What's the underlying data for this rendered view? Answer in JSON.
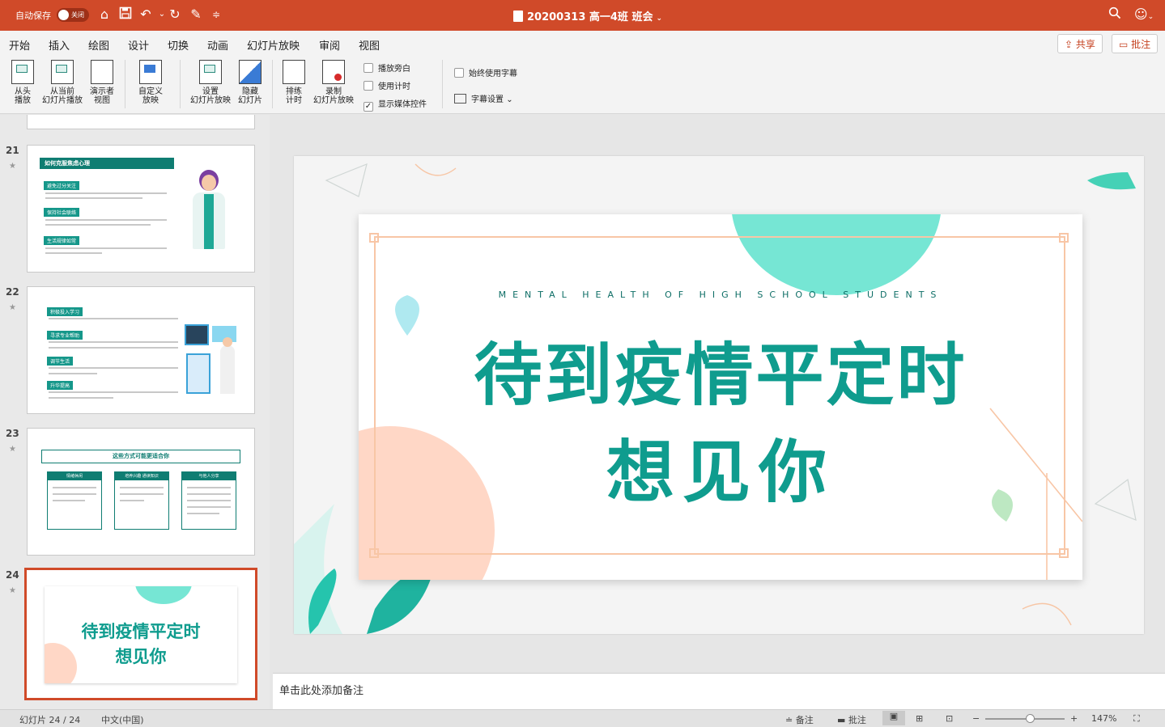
{
  "titlebar": {
    "autosave_label": "自动保存",
    "autosave_state": "关闭",
    "document_title": "20200313 高一4班 班会"
  },
  "tabs": [
    "开始",
    "插入",
    "绘图",
    "设计",
    "切换",
    "动画",
    "幻灯片放映",
    "审阅",
    "视图"
  ],
  "active_tab": "幻灯片放映",
  "share_label": "共享",
  "comment_label": "批注",
  "ribbon": {
    "from_start": [
      "从头",
      "播放"
    ],
    "from_current": [
      "从当前",
      "幻灯片播放"
    ],
    "presenter": [
      "演示者",
      "视图"
    ],
    "custom": [
      "自定义",
      "放映"
    ],
    "setup": [
      "设置",
      "幻灯片放映"
    ],
    "hide": [
      "隐藏",
      "幻灯片"
    ],
    "rehearse": [
      "排练",
      "计时"
    ],
    "record": [
      "录制",
      "幻灯片放映"
    ],
    "play_narrations": "播放旁白",
    "use_timings": "使用计时",
    "show_media_controls": "显示媒体控件",
    "always_subtitles": "始终使用字幕",
    "subtitle_settings": "字幕设置"
  },
  "thumbnails": [
    {
      "number": "21",
      "heading": "如何克服焦虑心理",
      "tags": [
        "避免过分关注",
        "保持社会联络",
        "生活规律如常"
      ]
    },
    {
      "number": "22",
      "tags": [
        "积极投入学习",
        "寻求专业帮助",
        "调节生活",
        "升华提高"
      ]
    },
    {
      "number": "23",
      "heading": "这些方式可能更适合你",
      "columns": [
        "情绪休闲",
        "培养兴趣 通读知识",
        "与他人分享"
      ]
    },
    {
      "number": "24",
      "title_line1": "待到疫情平定时",
      "title_line2": "想见你"
    }
  ],
  "slide": {
    "subtitle": "MENTAL HEALTH OF HIGH SCHOOL STUDENTS",
    "title_line1": "待到疫情平定时",
    "title_line2": "想见你"
  },
  "notes_placeholder": "单击此处添加备注",
  "statusbar": {
    "slide_counter": "幻灯片 24 / 24",
    "language": "中文(中国)",
    "notes": "备注",
    "comments": "批注",
    "zoom": "147%"
  },
  "colors": {
    "titlebar": "#d04a29",
    "teal": "#0f9c8e",
    "mint": "#76e6d4",
    "peach": "#ffd7c6"
  }
}
